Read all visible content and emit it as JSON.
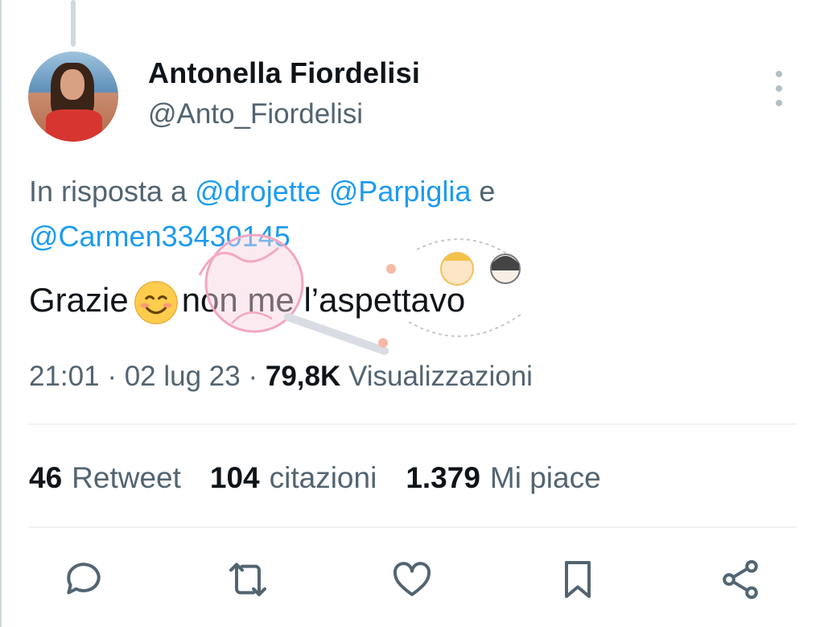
{
  "user": {
    "display_name": "Antonella Fiordelisi",
    "handle": "@Anto_Fiordelisi"
  },
  "reply": {
    "prefix": "In risposta a",
    "mentions": [
      "@drojette",
      "@Parpiglia",
      "@Carmen33430145"
    ],
    "joiner": "e"
  },
  "tweet": {
    "text_before_emoji": "Grazie",
    "emoji": "smiling-face-emoji",
    "text_after_emoji": "non me l’aspettavo"
  },
  "meta": {
    "time": "21:01",
    "date": "02 lug 23",
    "separator": "·",
    "views_count": "79,8K",
    "views_label": "Visualizzazioni"
  },
  "stats": {
    "retweets": {
      "count": "46",
      "label": "Retweet"
    },
    "quotes": {
      "count": "104",
      "label": "citazioni"
    },
    "likes": {
      "count": "1.379",
      "label": "Mi piace"
    }
  },
  "actions": [
    "reply-icon",
    "retweet-icon",
    "like-icon",
    "bookmark-icon",
    "share-icon"
  ],
  "colors": {
    "link": "#1d9bf0",
    "secondary": "#536471",
    "primary_text": "#0f1419"
  }
}
